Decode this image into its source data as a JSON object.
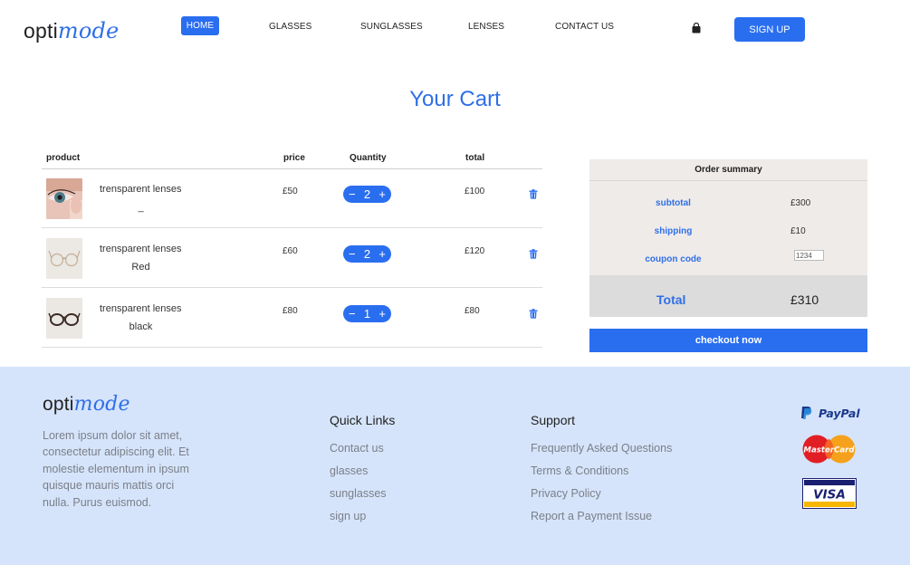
{
  "brand": {
    "logo_prefix": "opti",
    "logo_suffix": "mode"
  },
  "nav": {
    "items": [
      {
        "label": "HOME",
        "active": true
      },
      {
        "label": "GLASSES",
        "active": false
      },
      {
        "label": "SUNGLASSES",
        "active": false
      },
      {
        "label": "LENSES",
        "active": false
      },
      {
        "label": "CONTACT US",
        "active": false
      }
    ],
    "cart_icon": "shopping-bag-icon",
    "signup_label": "SIGN UP"
  },
  "page_title": "Your Cart",
  "cart": {
    "headers": {
      "product": "product",
      "price": "price",
      "quantity": "Quantity",
      "total": "total"
    },
    "items": [
      {
        "name": "trensparent lenses",
        "variant": "_",
        "price": "£50",
        "quantity": "2",
        "total": "£100",
        "image": "eye-lens-photo"
      },
      {
        "name": "trensparent lenses",
        "variant": "Red",
        "price": "£60",
        "quantity": "2",
        "total": "£120",
        "image": "glasses-photo"
      },
      {
        "name": "trensparent lenses",
        "variant": "black",
        "price": "£80",
        "quantity": "1",
        "total": "£80",
        "image": "glasses-photo"
      }
    ],
    "decrement_symbol": "−",
    "increment_symbol": "+",
    "delete_icon": "trash-icon"
  },
  "summary": {
    "title": "Order summary",
    "subtotal_label": "subtotal",
    "subtotal_value": "£300",
    "shipping_label": "shipping",
    "shipping_value": "£10",
    "coupon_label": "coupon code",
    "coupon_value": "1234",
    "total_label": "Total",
    "total_value": "£310",
    "checkout_label": "checkout now"
  },
  "footer": {
    "description": "Lorem ipsum dolor sit amet, consectetur adipiscing elit. Et molestie elementum in ipsum quisque mauris mattis orci nulla. Purus euismod.",
    "quick_links_title": "Quick Links",
    "quick_links": [
      "Contact us",
      "glasses",
      "sunglasses",
      "sign up"
    ],
    "support_title": "Support",
    "support_links": [
      "Frequently Asked Questions",
      "Terms & Conditions",
      "Privacy Policy",
      "Report a Payment Issue"
    ],
    "payments": {
      "paypal": "PayPal",
      "mastercard": "MasterCard",
      "visa": "VISA"
    }
  },
  "colors": {
    "accent": "#2a6ef0",
    "footer_bg": "#d6e4fb",
    "summary_bg": "#efebe9"
  }
}
